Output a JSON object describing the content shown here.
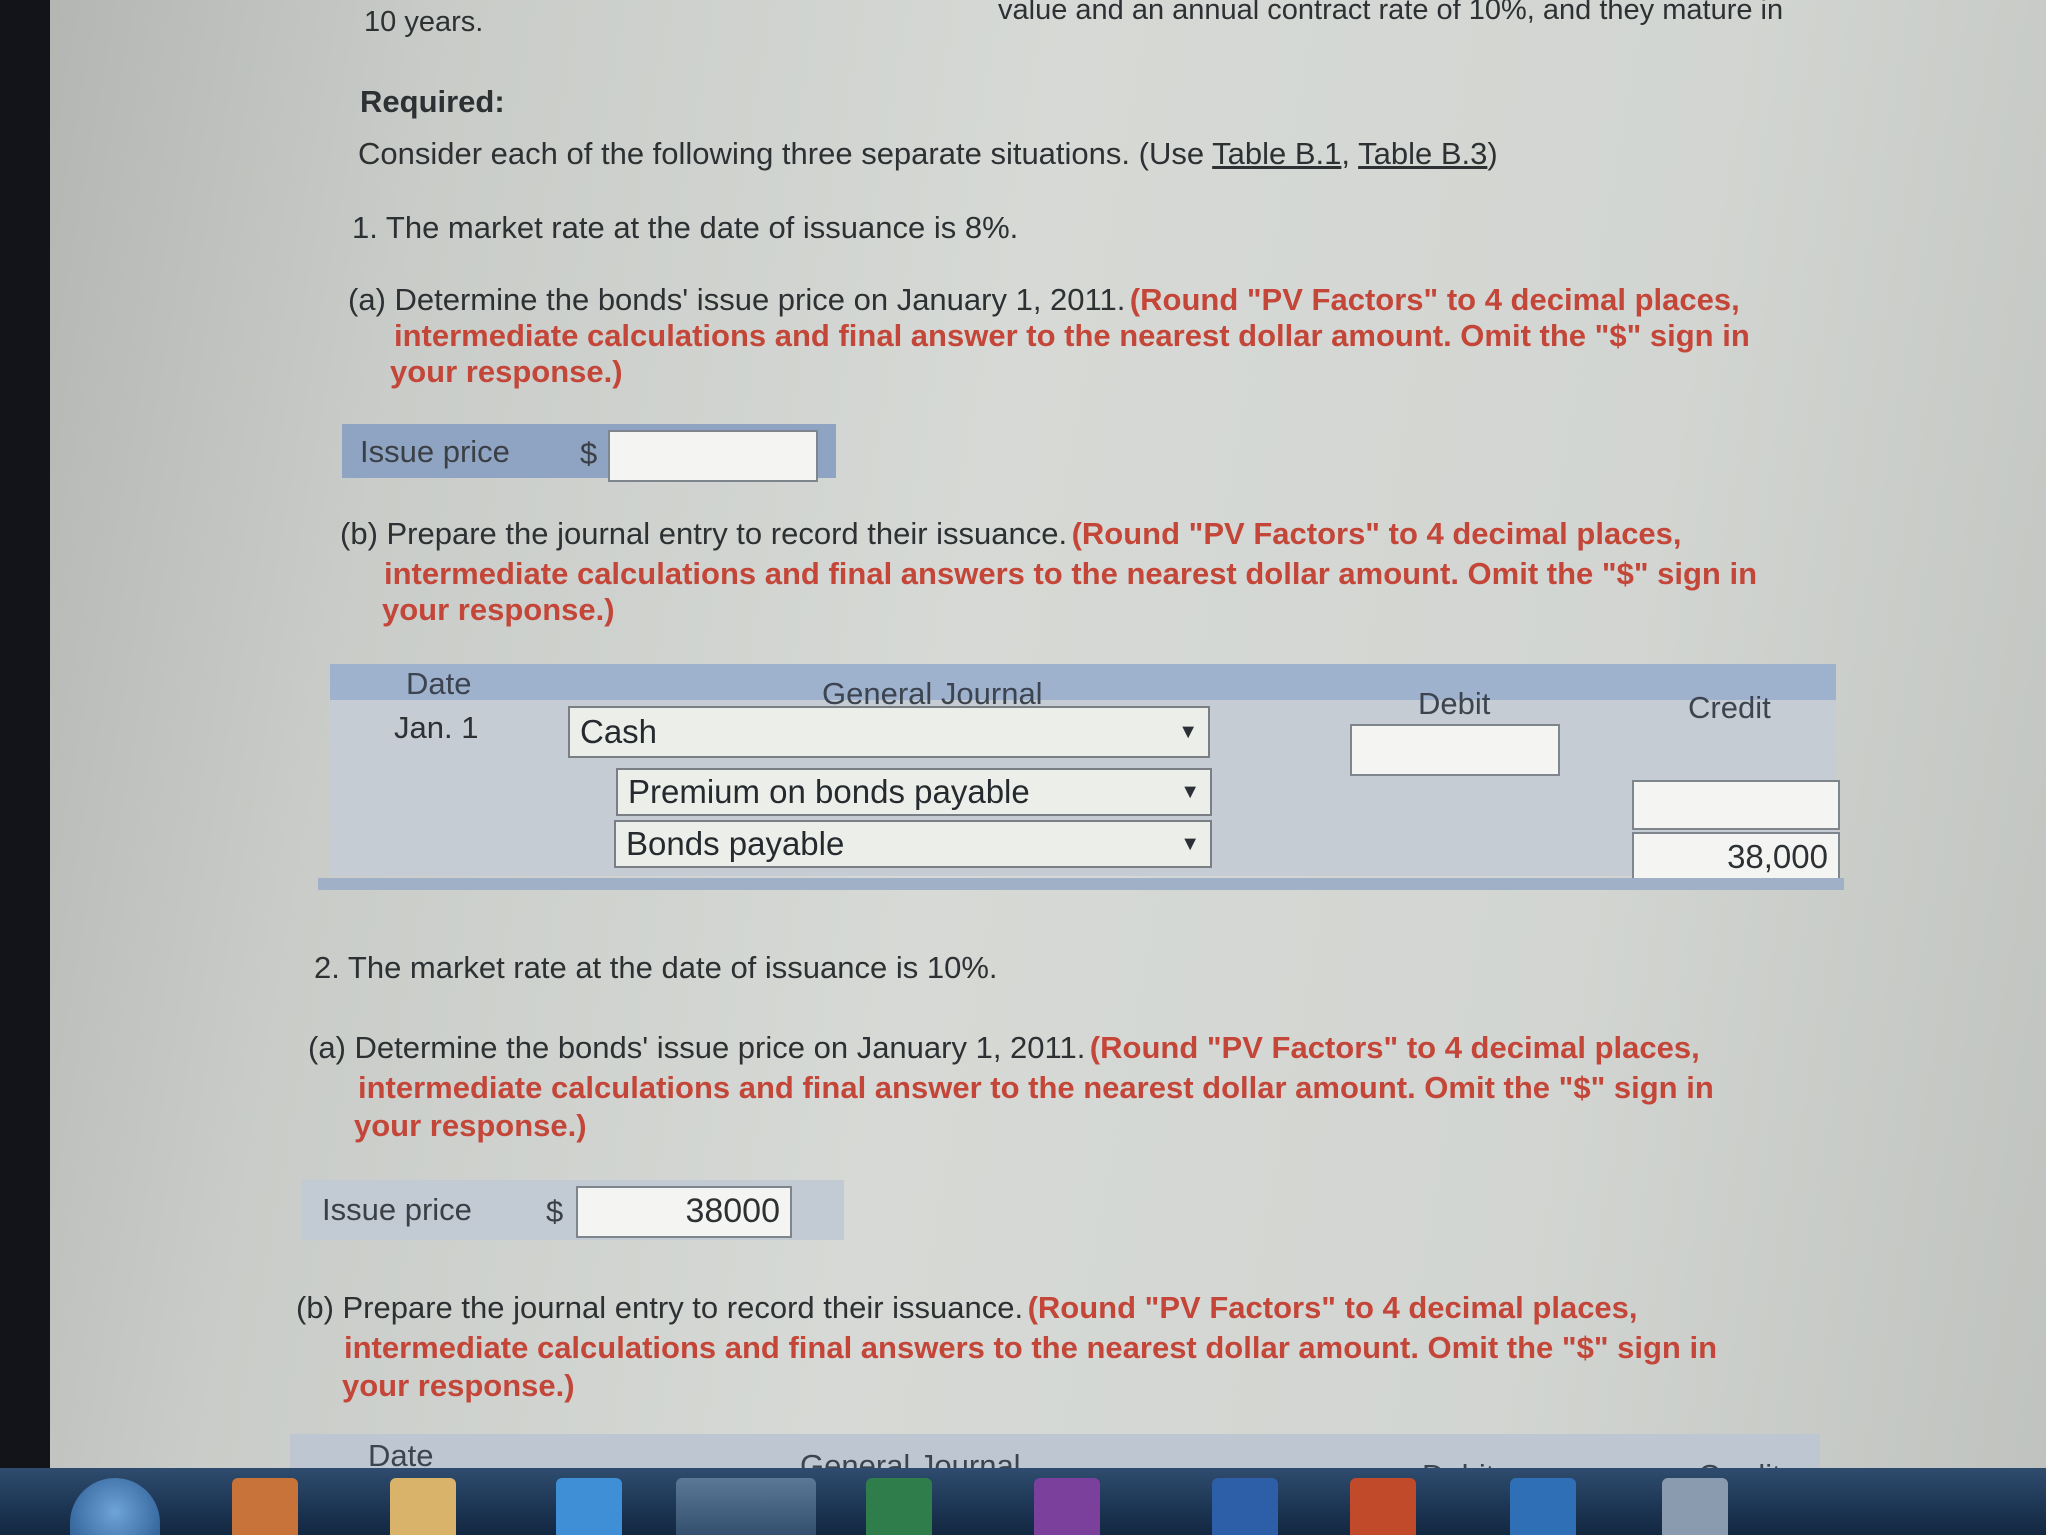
{
  "header": {
    "top_fragment": "10 years.",
    "top_line_right": "value and an annual contract rate of 10%, and they mature in"
  },
  "required_label": "Required:",
  "instructions": {
    "text": "Consider each of the following three separate situations. (Use",
    "link1": "Table B.1",
    "sep": ",",
    "link2": "Table B.3",
    "close": ")"
  },
  "situation1": {
    "heading": "1.  The market rate at the date of issuance is 8%.",
    "part_a": {
      "prefix": "(a) Determine the bonds' issue price on January 1, 2011.",
      "note_l1": "(Round \"PV Factors\" to 4 decimal places,",
      "note_l2": "intermediate calculations and final answer to the nearest dollar amount. Omit the \"$\" sign in",
      "note_l3": "your response.)",
      "issue_label": "Issue price",
      "currency": "$",
      "issue_value": ""
    },
    "part_b": {
      "prefix": "(b) Prepare the journal entry to record their issuance.",
      "note_l1": "(Round \"PV Factors\" to 4 decimal places,",
      "note_l2": "intermediate calculations and final answers to the nearest dollar amount. Omit the \"$\" sign in",
      "note_l3": "your response.)"
    },
    "journal": {
      "headers": [
        "Date",
        "General Journal",
        "Debit",
        "Credit"
      ],
      "date": "Jan. 1",
      "rows": [
        {
          "account": "Cash",
          "debit": "",
          "credit": ""
        },
        {
          "account": "Premium on bonds payable",
          "debit": "",
          "credit": ""
        },
        {
          "account": "Bonds payable",
          "debit": "",
          "credit": "38,000"
        }
      ]
    }
  },
  "situation2": {
    "heading": "2.  The market rate at the date of issuance is 10%.",
    "part_a": {
      "prefix": "(a) Determine the bonds' issue price on January 1, 2011.",
      "note_l1": "(Round \"PV Factors\" to 4 decimal places,",
      "note_l2": "intermediate calculations and final answer to the nearest dollar amount. Omit the \"$\" sign in",
      "note_l3": "your response.)",
      "issue_label": "Issue price",
      "currency": "$",
      "issue_value": "38000"
    },
    "part_b": {
      "prefix": "(b) Prepare the journal entry to record their issuance.",
      "note_l1": "(Round \"PV Factors\" to 4 decimal places,",
      "note_l2": "intermediate calculations and final answers to the nearest dollar amount. Omit the \"$\" sign in",
      "note_l3": "your response.)"
    },
    "journal": {
      "headers": [
        "Date",
        "General Journal",
        "Debit",
        "Credit"
      ]
    }
  },
  "select_arrow": "▼",
  "taskbar": {
    "icons": [
      "windows-start-icon",
      "media-player-icon",
      "file-explorer-icon",
      "internet-explorer-icon",
      "chrome-icon",
      "excel-icon",
      "onenote-icon",
      "word-icon",
      "powerpoint-icon",
      "outlook-icon",
      "app-icon"
    ]
  },
  "colors": {
    "accent_blue": "#9fb2cd",
    "instruction_red": "#c44639",
    "page_bg": "#d2d5d1"
  }
}
